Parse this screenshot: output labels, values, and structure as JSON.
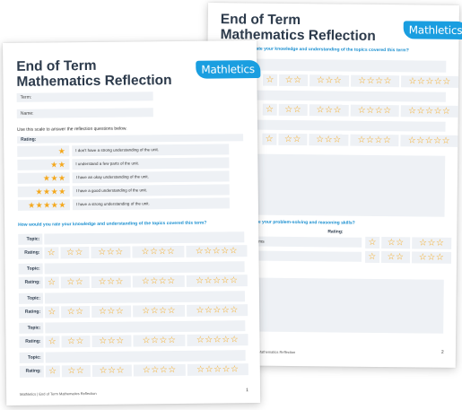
{
  "back_page": {
    "title_line1": "End of Term",
    "title_line2": "Mathematics Reflection",
    "logo": "Mathletics",
    "question1": "How would you rate your knowledge and understanding of the topics covered this term?",
    "question2_partial": "ate your problem-solving and reasoning skills?",
    "rating_header": "Rating:",
    "row1_partial": "ems",
    "row2_partial": "e",
    "footer_partial": "rm Mathematics Reflection",
    "page_number": "2"
  },
  "front_page": {
    "title_line1": "End of Term",
    "title_line2": "Mathematics Reflection",
    "logo": "Mathletics",
    "term_label": "Term:",
    "name_label": "Name:",
    "instruction": "Use this scale to answer the reflection questions below.",
    "rating_header": "Rating:",
    "scale": [
      {
        "stars": "★",
        "text": "I don't have a strong understanding of the unit."
      },
      {
        "stars": "★★",
        "text": "I understand a few parts of the unit."
      },
      {
        "stars": "★★★",
        "text": "I have an okay understanding of the unit."
      },
      {
        "stars": "★★★★",
        "text": "I have a good understanding of the unit."
      },
      {
        "stars": "★★★★★",
        "text": "I have a strong understanding of the unit."
      }
    ],
    "question": "How would you rate your knowledge and understanding of the topics covered this term?",
    "topic_label": "Topic:",
    "rating_label": "Rating:",
    "star_options": [
      "☆",
      "☆☆",
      "☆☆☆",
      "☆☆☆☆",
      "☆☆☆☆☆"
    ],
    "footer": "Mathletics | End of Term Mathematics Reflection",
    "page_number": "1"
  }
}
